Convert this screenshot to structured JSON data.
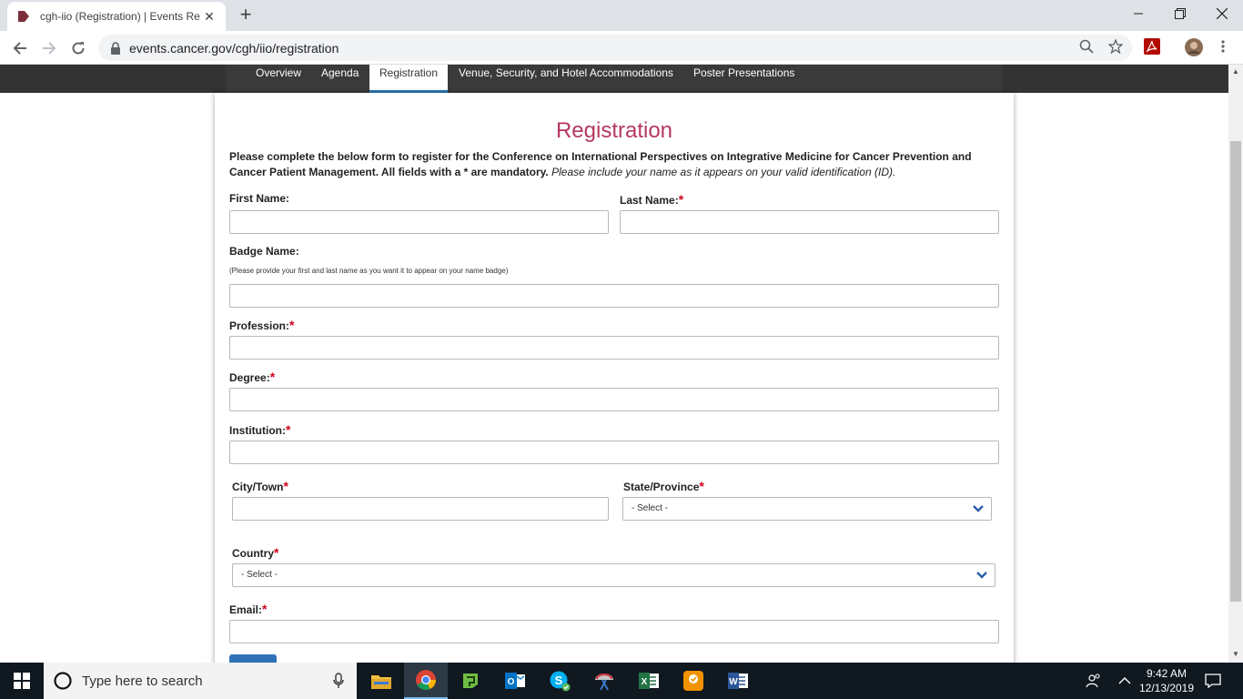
{
  "browser": {
    "tab_title": "cgh-iio (Registration) | Events Re",
    "url": "events.cancer.gov/cgh/iio/registration"
  },
  "site_nav": {
    "items": [
      {
        "label": "Overview"
      },
      {
        "label": "Agenda"
      },
      {
        "label": "Registration"
      },
      {
        "label": "Venue, Security, and Hotel Accommodations"
      },
      {
        "label": "Poster Presentations"
      }
    ]
  },
  "form": {
    "heading": "Registration",
    "intro_bold": "Please complete the below form to register for the Conference on International Perspectives on Integrative Medicine for Cancer Prevention and Cancer Patient Management. All fields with a * are mandatory.",
    "intro_italic": "Please include your name as it appears on your valid identification (ID).",
    "required_mark": "*",
    "first_name_label": "First Name:",
    "last_name_label": "Last Name:",
    "badge_name_label": "Badge Name:",
    "badge_name_hint": "(Please provide your first and last name as you want it to appear on your name badge)",
    "profession_label": "Profession:",
    "degree_label": "Degree:",
    "institution_label": "Institution:",
    "city_label": "City/Town",
    "state_label": "State/Province",
    "state_selected": "- Select -",
    "country_label": "Country",
    "country_selected": "- Select -",
    "email_label": "Email:",
    "accent_color": "#b5375e",
    "required_color": "#d0021b"
  },
  "taskbar": {
    "search_placeholder": "Type here to search",
    "time": "9:42 AM",
    "date": "12/13/2019"
  }
}
